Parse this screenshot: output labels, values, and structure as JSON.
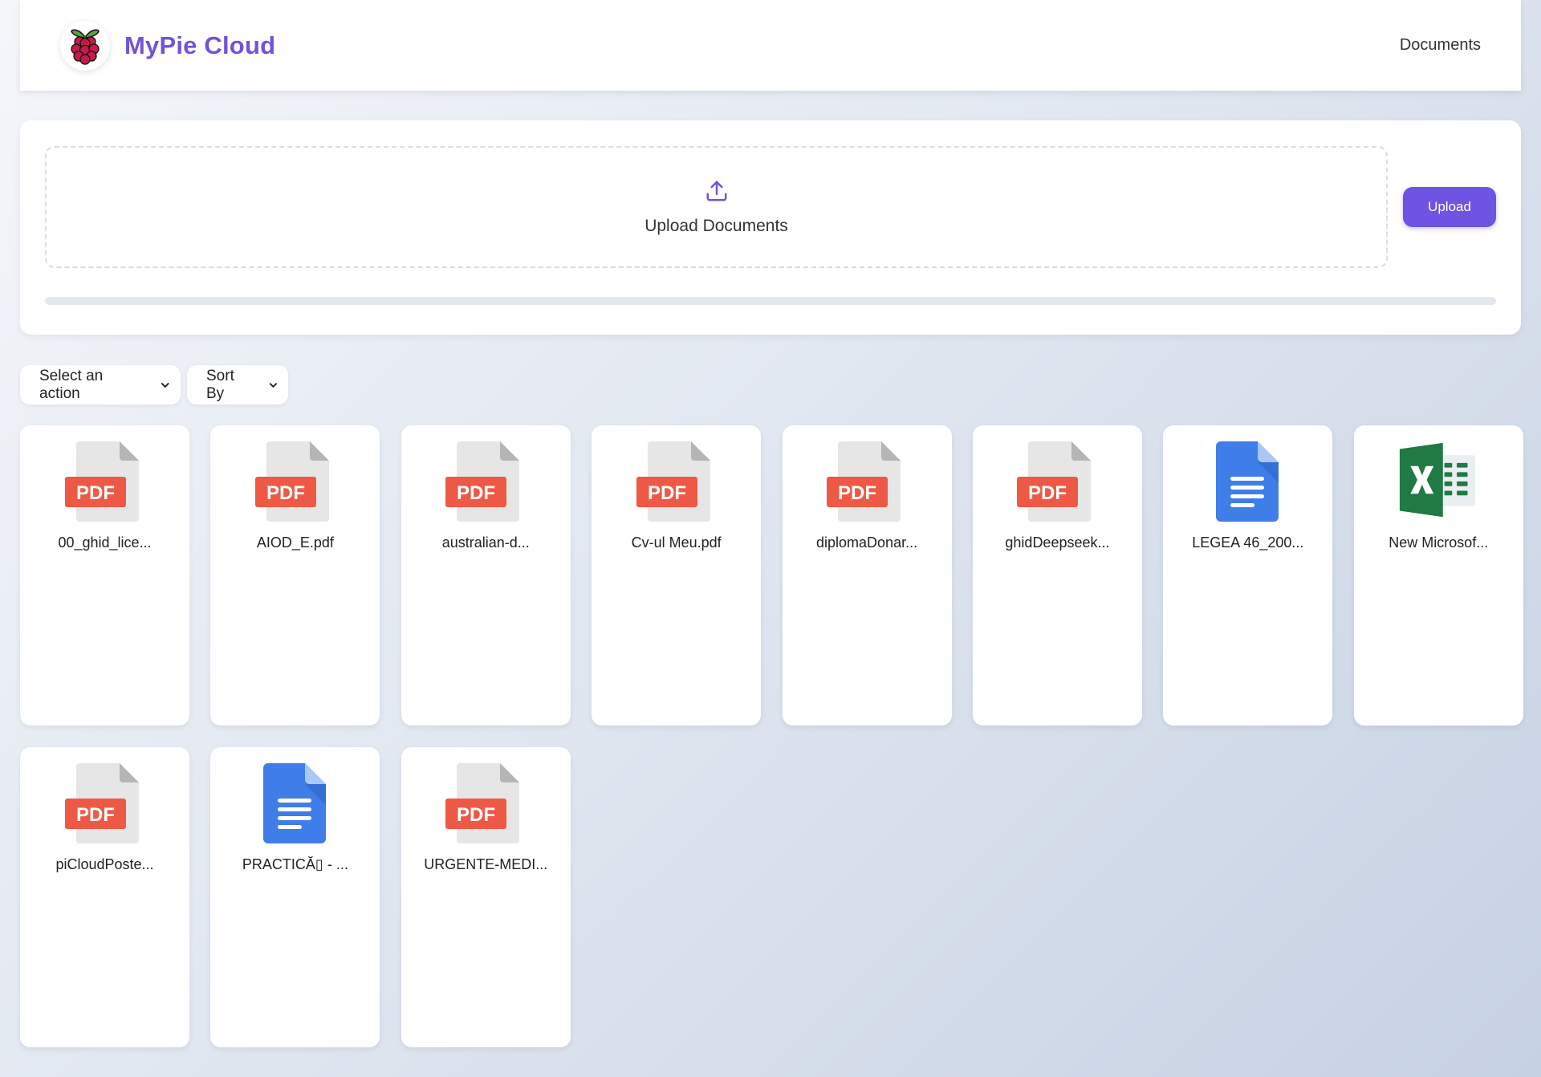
{
  "header": {
    "title": "MyPie Cloud",
    "logo_icon": "raspberry-pi-logo-icon",
    "nav": [
      {
        "label": "Documents"
      }
    ]
  },
  "upload": {
    "dropzone_label": "Upload Documents",
    "dropzone_icon": "upload-icon",
    "button_label": "Upload",
    "progress": 0
  },
  "controls": {
    "action_select": {
      "selected": "Select an action"
    },
    "sort_select": {
      "selected": "Sort By"
    }
  },
  "files": [
    {
      "name": "00_ghid_lice...",
      "type": "pdf"
    },
    {
      "name": "AIOD_E.pdf",
      "type": "pdf"
    },
    {
      "name": "australian-d...",
      "type": "pdf"
    },
    {
      "name": "Cv-ul Meu.pdf",
      "type": "pdf"
    },
    {
      "name": "diplomaDonar...",
      "type": "pdf"
    },
    {
      "name": "ghidDeepseek...",
      "type": "pdf"
    },
    {
      "name": "LEGEA 46_200...",
      "type": "doc"
    },
    {
      "name": "New Microsof...",
      "type": "xls"
    },
    {
      "name": "piCloudPoste...",
      "type": "pdf"
    },
    {
      "name": "PRACTICĂ▯ - ...",
      "type": "doc"
    },
    {
      "name": "URGENTE-MEDI...",
      "type": "pdf"
    }
  ],
  "icon_labels": {
    "pdf": "PDF"
  },
  "colors": {
    "accent": "#6e54e2",
    "brand_title": "#7152db",
    "pdf_red": "#ee5945",
    "doc_blue": "#3f7ee8",
    "xls_green": "#1f7a44"
  }
}
